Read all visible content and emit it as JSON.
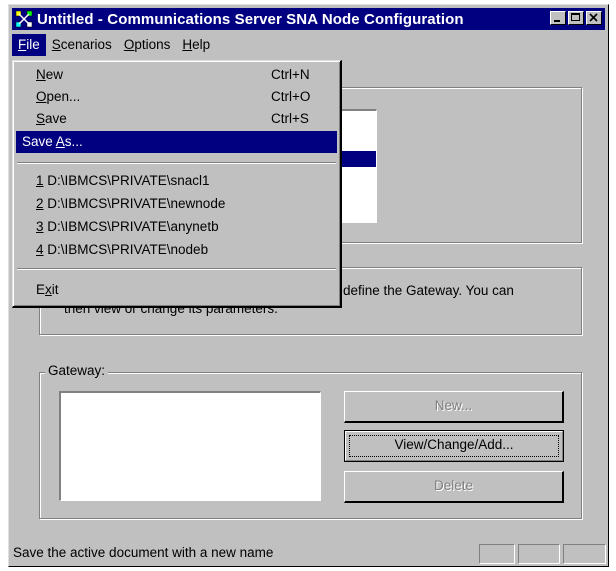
{
  "window": {
    "title": "Untitled - Communications Server SNA Node Configuration"
  },
  "menubar": [
    {
      "label": "File",
      "mnemonic": "F",
      "rest": "ile"
    },
    {
      "label": "Scenarios",
      "mnemonic": "S",
      "rest": "cenarios"
    },
    {
      "label": "Options",
      "mnemonic": "O",
      "rest": "ptions"
    },
    {
      "label": "Help",
      "mnemonic": "H",
      "rest": "elp"
    }
  ],
  "file_menu": {
    "new": {
      "pre": "",
      "mn": "N",
      "post": "ew",
      "shortcut": "Ctrl+N"
    },
    "open": {
      "pre": "",
      "mn": "O",
      "post": "pen...",
      "shortcut": "Ctrl+O"
    },
    "save": {
      "pre": "",
      "mn": "S",
      "post": "ave",
      "shortcut": "Ctrl+S"
    },
    "save_as": {
      "pre": "Save ",
      "mn": "A",
      "post": "s..."
    },
    "recent": [
      {
        "mn": "1",
        "text": " D:\\IBMCS\\PRIVATE\\snacl1"
      },
      {
        "mn": "2",
        "text": " D:\\IBMCS\\PRIVATE\\newnode"
      },
      {
        "mn": "3",
        "text": " D:\\IBMCS\\PRIVATE\\anynetb"
      },
      {
        "mn": "4",
        "text": " D:\\IBMCS\\PRIVATE\\nodeb"
      }
    ],
    "exit": {
      "pre": "E",
      "mn": "x",
      "post": "it"
    }
  },
  "main": {
    "desc_line1": "define the Gateway. You can",
    "desc_line2": "then view or change its parameters.",
    "gateway": {
      "label": "Gateway:",
      "new_button": "New...",
      "view_button": "View/Change/Add...",
      "delete_button": "Delete"
    }
  },
  "status": {
    "text": "Save the active document with a new name"
  },
  "colors": {
    "titlebar": "#000080",
    "face": "#c0c0c0",
    "highlight": "#000080"
  }
}
